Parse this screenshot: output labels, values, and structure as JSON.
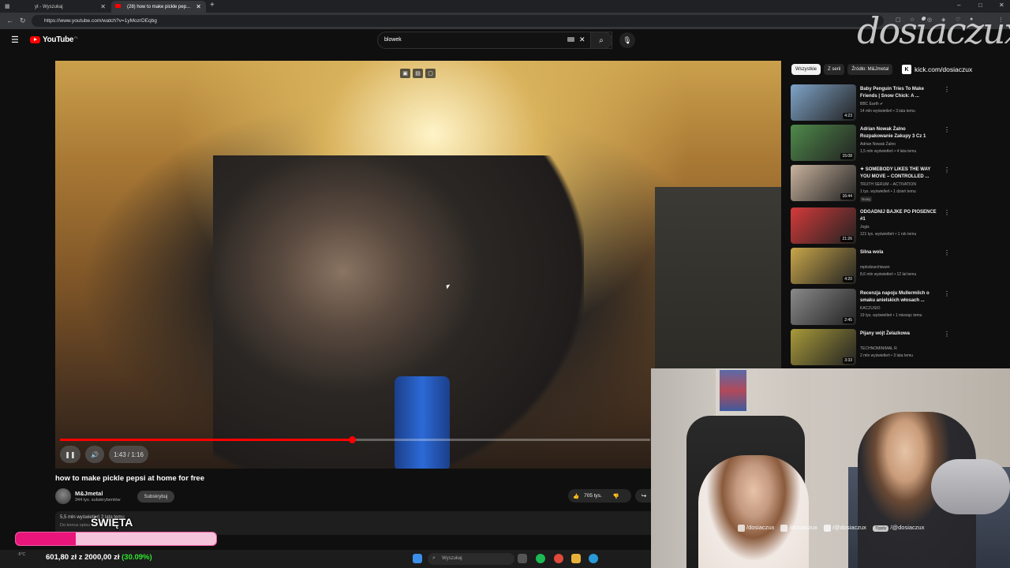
{
  "browser": {
    "tabs": [
      {
        "label": "yt - Wyszukaj"
      },
      {
        "label": "(28) how to make pickle pep..."
      }
    ],
    "new_tab": "+",
    "url": "https://www.youtube.com/watch?v=1yMozrDEqbg",
    "window_controls": [
      "–",
      "□",
      "✕"
    ]
  },
  "youtube": {
    "logo_text": "YouTube",
    "region": "PL",
    "search_value": "blowek",
    "clear_icon": "✕",
    "search_icon": "⌕",
    "mic_icon": "🎙"
  },
  "player": {
    "progress_fraction": 0.495,
    "time": "1:43 / 1:16",
    "pause_icon": "❚❚",
    "volume_icon": "🔊",
    "pip_icons": [
      "▣",
      "▤",
      "▢"
    ]
  },
  "video": {
    "title": "how to make pickle pepsi at home for free",
    "channel": "M&Jmetal",
    "subscribers": "344 tys. subskrybentów",
    "subscribe_label": "Subskrybuj",
    "likes": "705 tys.",
    "desc_line1": "5,5 mln wyświetleń  2 lata temu",
    "desc_line2": "Do konca opisu"
  },
  "recommendations": {
    "chips": [
      {
        "label": "Wszystkie",
        "selected": true
      },
      {
        "label": "Z serii",
        "selected": false
      },
      {
        "label": "Źródło: M&Jmetal",
        "selected": false
      }
    ],
    "items": [
      {
        "title": "Baby Penguin Tries To Make Friends | Snow Chick: A ...",
        "channel": "BBC Earth ✔",
        "meta": "14 mln wyświetleń • 3 lata temu",
        "duration": "4:23",
        "thumb": "#7fa4c8"
      },
      {
        "title": "Adrian Nowak Żalno Rozpakowanie Zakupy 3 Cz 1",
        "channel": "Adrian Nowak Żalno",
        "meta": "1,5 mln wyświetleń • 4 lata temu",
        "duration": "15:08",
        "thumb": "#4f8a4a"
      },
      {
        "title": "✦ SOMEBODY LIKES THE WAY YOU MOVE – CONTROLLED ...",
        "channel": "TRUTH SERUM – ACTIVATION",
        "meta": "1 tys. wyświetleń • 1 dzień temu",
        "badge": "Nowy",
        "duration": "16:44",
        "thumb": "#c9b39e"
      },
      {
        "title": "ODGADNIJ BAJKE PO PIOSENCE #1",
        "channel": "Jogis",
        "meta": "121 tys. wyświetleń • 1 rok temu",
        "duration": "21:26",
        "thumb": "#d43a3a"
      },
      {
        "title": "Silna wola",
        "channel": "mplodzarchiwum",
        "meta": "8,6 mln wyświetleń • 12 lat temu",
        "duration": "4:20",
        "thumb": "#c8a64a"
      },
      {
        "title": "Recenzja napoju Mullermilch o smaku anielskich włosach ...",
        "channel": "KACZUSIO",
        "meta": "19 tys. wyświetleń • 1 miesiąc temu",
        "duration": "2:45",
        "thumb": "#8a8a8a"
      },
      {
        "title": "Pijany wójt Żelazkowa",
        "channel": "TECHNOMINIMAL R",
        "meta": "2 mln wyświetleń • 3 lata temu",
        "duration": "3:33",
        "thumb": "#a89a3a"
      }
    ]
  },
  "stream": {
    "brand": "dosiaczux",
    "kick_icon": "K",
    "kick_url": "kick.com/dosiaczux",
    "socials": [
      {
        "icon": "instagram-icon",
        "text": "/dosiaczux"
      },
      {
        "icon": "tiktok-icon",
        "text": "/dosiaczux"
      },
      {
        "icon": "youtube-icon",
        "text": "/@dosiaczux"
      },
      {
        "icon": "tipply-icon",
        "tip": "Tipply",
        "text": "/@dosiaczux"
      }
    ],
    "goal_title": "ŚWIĘTA",
    "goal_fraction": 0.3009,
    "goal_amount": "601,80 zł z 2000,00 zł",
    "goal_percent": "(30.09%)"
  },
  "taskbar": {
    "search_placeholder": "Wyszukaj",
    "left_text": "-5°C"
  },
  "colors": {
    "yt_red": "#ff0000",
    "goal_fill": "#e9157a",
    "goal_bg": "#f5c3dc",
    "goal_percent": "#2ee82e"
  }
}
